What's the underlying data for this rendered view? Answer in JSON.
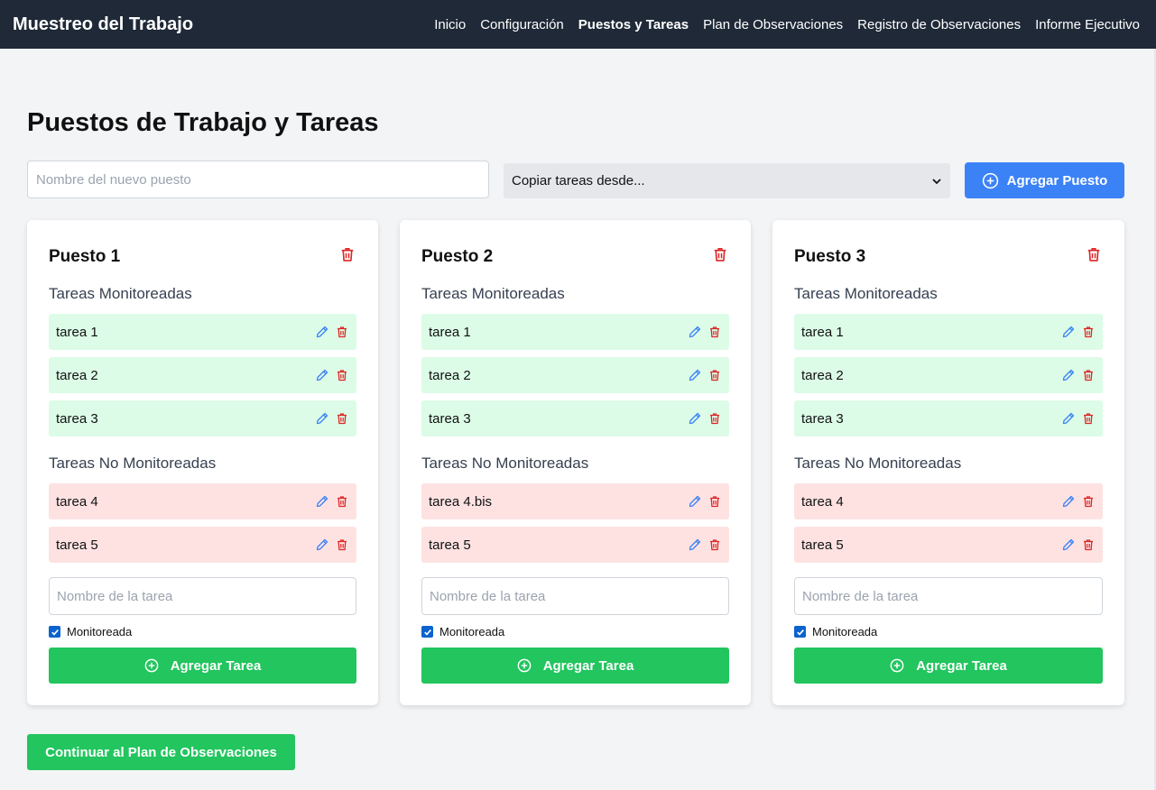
{
  "nav": {
    "brand": "Muestreo del Trabajo",
    "links": [
      "Inicio",
      "Configuración",
      "Puestos y Tareas",
      "Plan de Observaciones",
      "Registro de Observaciones",
      "Informe Ejecutivo"
    ],
    "active": "Puestos y Tareas"
  },
  "page": {
    "title": "Puestos de Trabajo y Tareas",
    "new_post_placeholder": "Nombre del nuevo puesto",
    "copy_select_value": "Copiar tareas desde...",
    "add_post_label": "Agregar Puesto",
    "continue_label": "Continuar al Plan de Observaciones"
  },
  "labels": {
    "monitored": "Tareas Monitoreadas",
    "not_monitored": "Tareas No Monitoreadas",
    "task_placeholder": "Nombre de la tarea",
    "monitored_checkbox": "Monitoreada",
    "add_task": "Agregar Tarea"
  },
  "posts": [
    {
      "name": "Puesto 1",
      "monitored": [
        "tarea 1",
        "tarea 2",
        "tarea 3"
      ],
      "not_monitored": [
        "tarea 4",
        "tarea 5"
      ]
    },
    {
      "name": "Puesto 2",
      "monitored": [
        "tarea 1",
        "tarea 2",
        "tarea 3"
      ],
      "not_monitored": [
        "tarea 4.bis",
        "tarea 5"
      ]
    },
    {
      "name": "Puesto 3",
      "monitored": [
        "tarea 1",
        "tarea 2",
        "tarea 3"
      ],
      "not_monitored": [
        "tarea 4",
        "tarea 5"
      ]
    }
  ],
  "colors": {
    "nav_bg": "#1f2937",
    "primary": "#3b82f6",
    "success": "#22c55e",
    "danger": "#dc2626",
    "monitored_bg": "#dcfce7",
    "not_monitored_bg": "#fee2e2"
  }
}
